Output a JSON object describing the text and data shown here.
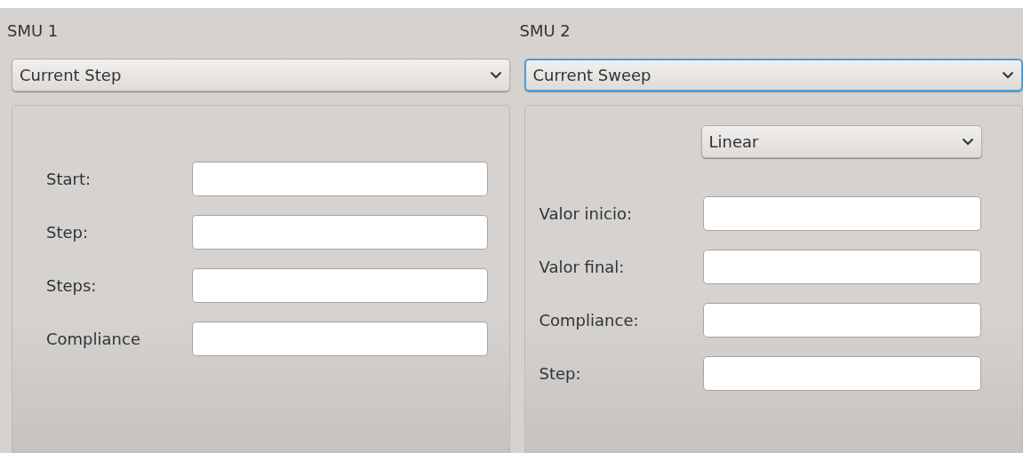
{
  "smus": [
    {
      "title": "SMU 1",
      "mode": {
        "value": "Current Step",
        "focused": false
      },
      "fields": [
        {
          "label": "Start:"
        },
        {
          "label": "Step:"
        },
        {
          "label": "Steps:"
        },
        {
          "label": "Compliance"
        }
      ]
    },
    {
      "title": "SMU 2",
      "mode": {
        "value": "Current Sweep",
        "focused": true
      },
      "sub_select": {
        "value": "Linear",
        "focused": false
      },
      "fields": [
        {
          "label": "Valor inicio:"
        },
        {
          "label": "Valor final:"
        },
        {
          "label": "Compliance:"
        },
        {
          "label": "Step:"
        }
      ]
    }
  ]
}
